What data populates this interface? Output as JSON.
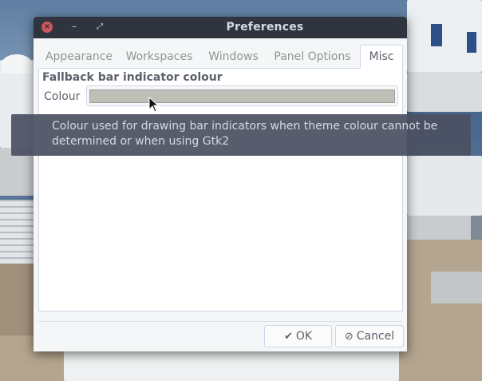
{
  "window": {
    "title": "Preferences",
    "controls": {
      "close_icon": "×",
      "minimize_icon": "–",
      "maximize_icon": "⤢"
    }
  },
  "tabs": [
    {
      "label": "Appearance",
      "active": false
    },
    {
      "label": "Workspaces",
      "active": false
    },
    {
      "label": "Windows",
      "active": false
    },
    {
      "label": "Panel Options",
      "active": false
    },
    {
      "label": "Misc",
      "active": true
    }
  ],
  "misc": {
    "section_title": "Fallback bar indicator colour",
    "colour_label": "Colour",
    "colour_value": "#bfbfb8"
  },
  "tooltip": {
    "text": "Colour used for drawing bar indicators when theme colour cannot be determined or when using Gtk2"
  },
  "buttons": {
    "ok": {
      "label": "OK",
      "icon": "✔"
    },
    "cancel": {
      "label": "Cancel",
      "icon": "⊘"
    }
  },
  "colors": {
    "titlebar": "#2f343f",
    "close": "#cc575d",
    "tooltip_bg": "#4b5162"
  }
}
